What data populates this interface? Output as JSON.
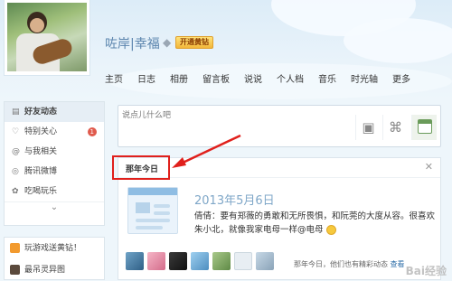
{
  "profile": {
    "username": "咗岸|幸福",
    "vip_badge": "开通黄钻"
  },
  "nav": [
    "主页",
    "日志",
    "相册",
    "留言板",
    "说说",
    "个人档",
    "音乐",
    "时光轴",
    "更多"
  ],
  "sidebar": {
    "items": [
      {
        "label": "好友动态",
        "icon": "news-feed-icon",
        "active": true
      },
      {
        "label": "特别关心",
        "icon": "heart-icon",
        "badge": "1"
      },
      {
        "label": "与我相关",
        "icon": "at-icon"
      },
      {
        "label": "腾讯微博",
        "icon": "weibo-icon"
      },
      {
        "label": "吃喝玩乐",
        "icon": "fun-icon"
      }
    ],
    "bottom_items": [
      {
        "label": "玩游戏送黄钻！",
        "icon": "game-icon"
      },
      {
        "label": "最吊灵异图",
        "icon": "picture-icon"
      }
    ]
  },
  "postbox": {
    "placeholder": "说点儿什么吧"
  },
  "card": {
    "title": "那年今日",
    "date": "2013年5月6日",
    "text": "倩倩：要有郑薇的勇敢和无所畏惧，和阮莞的大度从容。很喜欢朱小北，就像我家电母一样@电母",
    "footer_text": "那年今日，他们也有精彩动态",
    "footer_link": "查看"
  },
  "watermark": "Bai经验",
  "colors": {
    "accent": "#2d6ea8",
    "highlight": "#e0201c",
    "badge": "#e05a4c"
  }
}
